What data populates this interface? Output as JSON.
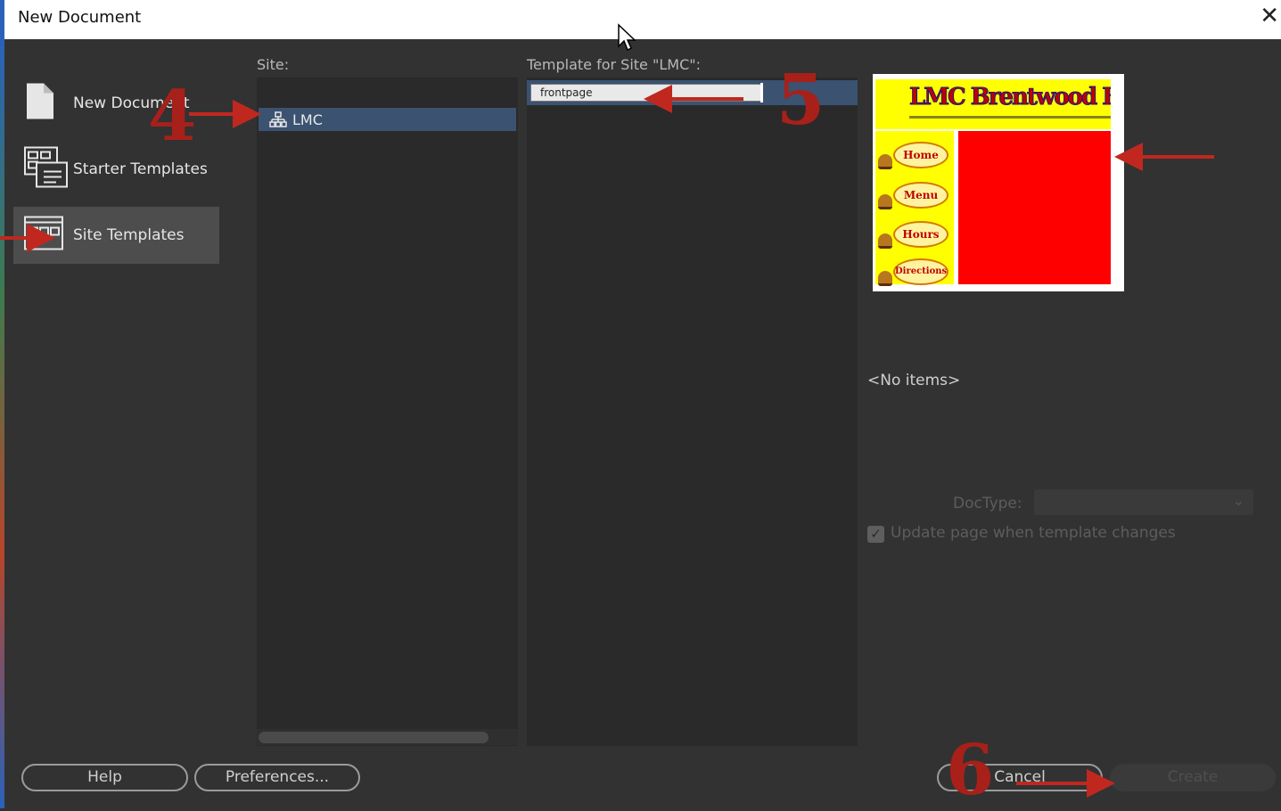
{
  "window": {
    "title": "New Document",
    "close_icon": "close-icon"
  },
  "categories": [
    {
      "label": "New Document",
      "icon": "blank-document-icon",
      "selected": false
    },
    {
      "label": "Starter Templates",
      "icon": "starter-templates-icon",
      "selected": false
    },
    {
      "label": "Site Templates",
      "icon": "site-templates-icon",
      "selected": true
    }
  ],
  "site_panel": {
    "header": "Site:",
    "items": [
      {
        "label": "LMC",
        "icon": "site-tree-icon",
        "selected": true
      }
    ]
  },
  "template_panel": {
    "header": "Template for Site \"LMC\":",
    "items": [
      {
        "label": "frontpage",
        "selected": true
      }
    ]
  },
  "preview": {
    "banner_text": "LMC Brentwood Burg",
    "nav_buttons": [
      "Home",
      "Menu",
      "Hours",
      "Directions"
    ],
    "colors": {
      "banner": "#ffff00",
      "content": "#ff0000",
      "title": "#c00000"
    }
  },
  "description": "<No items>",
  "options": {
    "doctype_label": "DocType:",
    "doctype_value": "",
    "update_label": "Update page when template changes",
    "update_checked": true
  },
  "buttons": {
    "help": "Help",
    "preferences": "Preferences...",
    "cancel": "Cancel",
    "create": "Create"
  },
  "annotations": {
    "step_site": "4",
    "step_template": "5",
    "step_create": "6",
    "color": "#a8201a"
  }
}
